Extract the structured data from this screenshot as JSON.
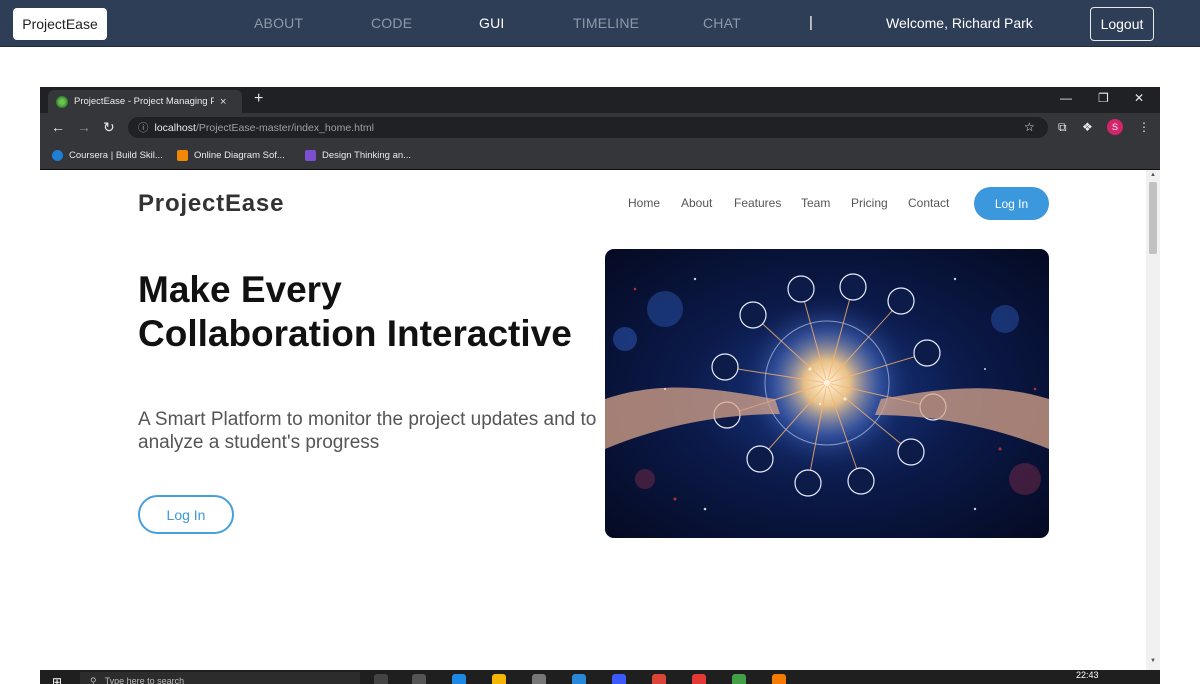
{
  "topbar": {
    "brand": "ProjectEase",
    "nav": [
      "ABOUT",
      "CODE",
      "GUI",
      "TIMELINE",
      "CHAT"
    ],
    "active": "GUI",
    "separator": "|",
    "welcome": "Welcome, Richard Park",
    "logout": "Logout"
  },
  "browser": {
    "tab_title": "ProjectEase - Project Managing P",
    "tab_close": "×",
    "new_tab": "+",
    "url_host": "localhost",
    "url_path": "/ProjectEase-master/index_home.html",
    "profile_initial": "S",
    "bookmarks": [
      "Coursera | Build Skil...",
      "Online Diagram Sof...",
      "Design Thinking an..."
    ]
  },
  "site": {
    "logo": "ProjectEase",
    "nav": [
      "Home",
      "About",
      "Features",
      "Team",
      "Pricing",
      "Contact"
    ],
    "login_button": "Log In",
    "hero_title": "Make Every Collaboration Interactive",
    "hero_subtitle": "A Smart Platform to monitor the project updates and to analyze a student's progress",
    "hero_login": "Log In"
  },
  "taskbar": {
    "search_placeholder": "Type here to search",
    "clock": "22:43"
  },
  "colors": {
    "topbar_bg": "#2e3e56",
    "accent_blue": "#3b98dd",
    "chrome_dark": "#202124"
  }
}
